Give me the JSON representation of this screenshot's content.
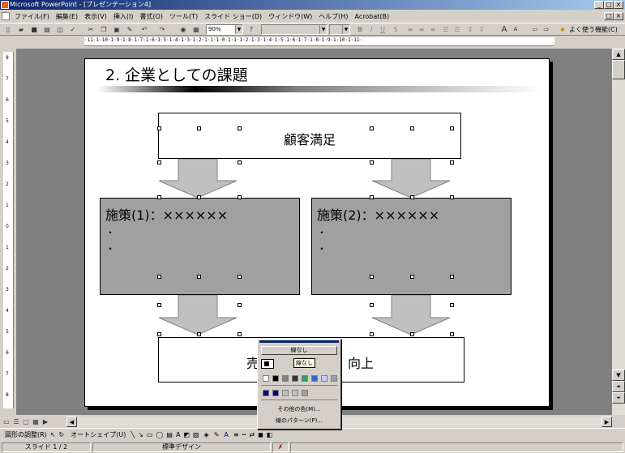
{
  "window": {
    "title": "Microsoft PowerPoint - [プレゼンテーション4]"
  },
  "menu": {
    "items": [
      "ファイル(F)",
      "編集(E)",
      "表示(V)",
      "挿入(I)",
      "書式(O)",
      "ツール(T)",
      "スライド ショー(D)",
      "ウィンドウ(W)",
      "ヘルプ(H)",
      "Acrobat(B)"
    ]
  },
  "toolbar": {
    "zoom": "90%",
    "frequent_label": "よく使う機能(C)"
  },
  "ruler": {
    "horizontal": "·11·1·10·1·9·1·8·1·7·1·6·1·5·1·4·1·3·1·2·1·1·1·0·1·1·1·2·1·3·1·4·1·5·1·6·1·7·1·8·1·9·1·10·1·11·",
    "vertical": [
      "8",
      "7",
      "6",
      "5",
      "4",
      "3",
      "2",
      "1",
      "0",
      "1",
      "2",
      "3",
      "4",
      "5",
      "6",
      "7",
      "8"
    ]
  },
  "slide": {
    "title": "2. 企業としての課題",
    "top_box": "顧客満足",
    "left_box": "施策(1)：××××××",
    "right_box": "施策(2)：××××××",
    "bullet": "・",
    "bottom_box_left": "売",
    "bottom_box_right": "向上"
  },
  "popup": {
    "no_line": "線なし",
    "tooltip": "線なし",
    "more_colors": "その他の色(M)...",
    "line_pattern": "線のパターン(P)...",
    "row1_colors": [
      "#ffffff",
      "#000000",
      "#808080",
      "#333333",
      "#339966",
      "#3366cc",
      "#ccccff",
      "#a0a0a0"
    ],
    "row2_colors": [
      "#000080",
      "#000080",
      "#c0c0c0",
      "#c0c0c0",
      "#a0a0a0"
    ]
  },
  "drawbar": {
    "adjust": "図形の調整(R)",
    "autoshape": "オートシェイプ(U)"
  },
  "status": {
    "slide": "スライド 1 / 2",
    "design": "標準デザイン"
  }
}
